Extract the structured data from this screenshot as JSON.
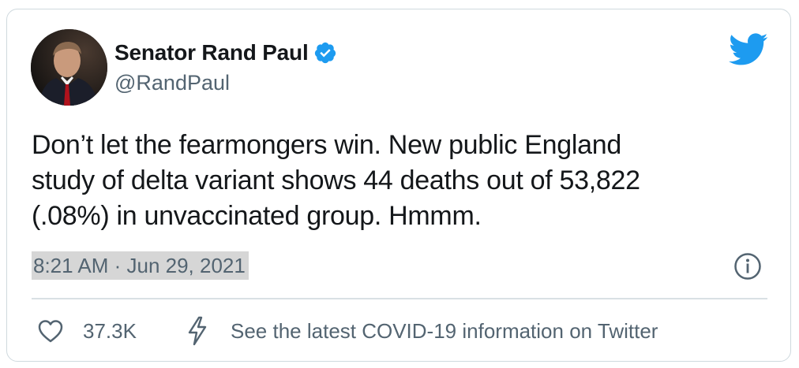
{
  "author": {
    "display_name": "Senator Rand Paul",
    "handle": "@RandPaul",
    "verified": true
  },
  "tweet": {
    "text_lines": [
      "Don’t let the fearmongers win. New public England",
      "study of delta variant shows 44 deaths out of 53,822",
      "(.08%) in unvaccinated group. Hmmm."
    ],
    "timestamp": "8:21 AM · Jun 29, 2021"
  },
  "footer": {
    "like_count": "37.3K",
    "covid_link": "See the latest COVID-19 information on Twitter"
  },
  "icons": {
    "brand": "twitter-bird-icon",
    "verified": "verified-badge-icon",
    "info": "info-icon",
    "like": "heart-icon",
    "covid": "lightning-bolt-icon"
  },
  "colors": {
    "twitter_blue": "#1d9bf0",
    "text_primary": "#14171a",
    "text_secondary": "#536471",
    "border": "#cfd9de"
  }
}
